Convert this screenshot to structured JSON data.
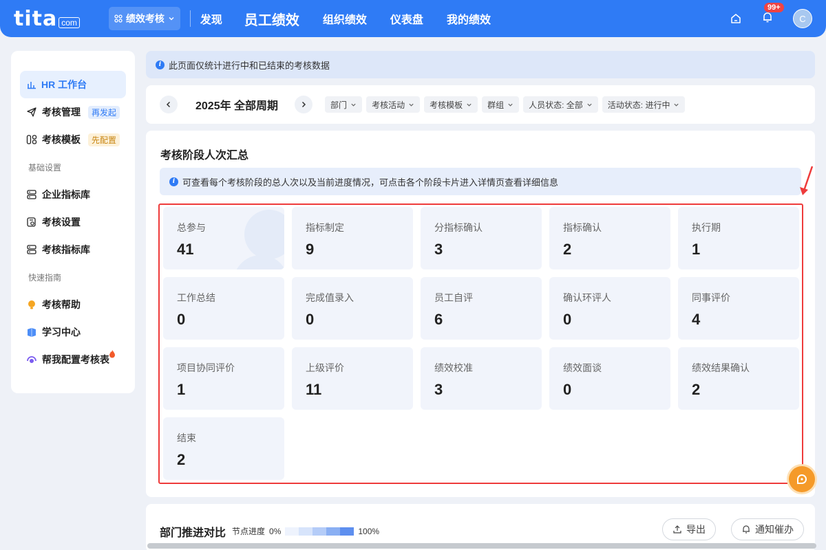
{
  "nav": {
    "logo_text": "tita",
    "logo_suffix": "com",
    "module_label": "绩效考核",
    "items": [
      "发现",
      "员工绩效",
      "组织绩效",
      "仪表盘",
      "我的绩效"
    ],
    "notification_badge": "99+",
    "avatar_letter": "C"
  },
  "sidebar": {
    "workbench": "HR 工作台",
    "manage": "考核管理",
    "manage_tag": "再发起",
    "template": "考核模板",
    "template_tag": "先配置",
    "group_basic": "基础设置",
    "enterprise_lib": "企业指标库",
    "settings": "考核设置",
    "indicator_lib": "考核指标库",
    "group_guide": "快速指南",
    "help": "考核帮助",
    "learning": "学习中心",
    "config_help": "帮我配置考核表"
  },
  "notice_top": "此页面仅统计进行中和已结束的考核数据",
  "filters": {
    "period": "2025年 全部周期",
    "chips": [
      "部门",
      "考核活动",
      "考核模板",
      "群组",
      "人员状态: 全部",
      "活动状态: 进行中"
    ]
  },
  "summary": {
    "title": "考核阶段人次汇总",
    "notice": "可查看每个考核阶段的总人次以及当前进度情况，可点击各个阶段卡片进入详情页查看详细信息",
    "cards": [
      {
        "label": "总参与",
        "value": "41"
      },
      {
        "label": "指标制定",
        "value": "9"
      },
      {
        "label": "分指标确认",
        "value": "3"
      },
      {
        "label": "指标确认",
        "value": "2"
      },
      {
        "label": "执行期",
        "value": "1"
      },
      {
        "label": "工作总结",
        "value": "0"
      },
      {
        "label": "完成值录入",
        "value": "0"
      },
      {
        "label": "员工自评",
        "value": "6"
      },
      {
        "label": "确认环评人",
        "value": "0"
      },
      {
        "label": "同事评价",
        "value": "4"
      },
      {
        "label": "项目协同评价",
        "value": "1"
      },
      {
        "label": "上级评价",
        "value": "11"
      },
      {
        "label": "绩效校准",
        "value": "3"
      },
      {
        "label": "绩效面谈",
        "value": "0"
      },
      {
        "label": "绩效结果确认",
        "value": "2"
      },
      {
        "label": "结束",
        "value": "2"
      }
    ]
  },
  "compare": {
    "title": "部门推进对比",
    "legend_label": "节点进度",
    "legend_min": "0%",
    "legend_max": "100%",
    "export": "导出",
    "notify": "通知催办"
  },
  "colors": {
    "brand": "#2f7bf5",
    "highlight_box": "#ee3b3b",
    "float_button": "#f59a29"
  }
}
